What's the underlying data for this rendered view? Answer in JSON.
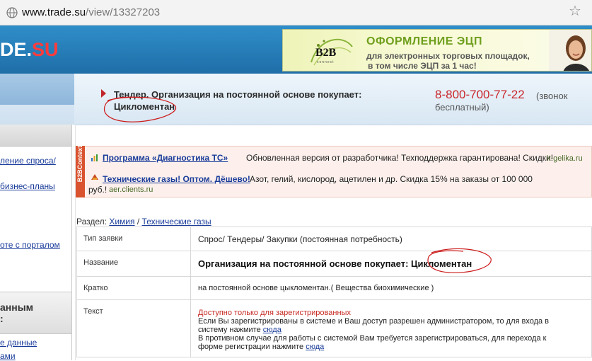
{
  "browser": {
    "url_domain": "www.trade.su",
    "url_path": "/view/13327203",
    "star_icon": "star-icon"
  },
  "header": {
    "logo_main": "DE",
    "logo_dot": ".",
    "logo_su": "SU"
  },
  "banner": {
    "brand": "B2B",
    "brand_sub": "connect",
    "title": "ОФОРМЛЕНИЕ ЭЦП",
    "line1": "для электронных торговых площадок,",
    "line2": "в том числе ЭЦП за 1 час!"
  },
  "tender": {
    "title_line1": "Тендер. Организация на постоянной основе покупает:",
    "title_line2": "Цикломентан"
  },
  "phone": {
    "number": "8-800-700-77-22",
    "note_part1": "(звонок",
    "note_part2": "бесплатный)"
  },
  "sidebar": {
    "links": [
      "ление спроса/",
      "бизнес-планы",
      "оте с порталом"
    ],
    "section_title_l1": "анным",
    "section_title_l2": ":",
    "bottom_links": [
      "е данные",
      "ами"
    ]
  },
  "ads": {
    "strip_label": "B2BContext",
    "items": [
      {
        "title": "Программа «Диагностика ТС»",
        "desc": "Обновленная версия от разработчика! Техподдержка гарантирована! Скидки!",
        "domain": "it-gelika.ru"
      },
      {
        "title": "Технические газы! Оптом. Дёшево!",
        "desc": "Азот, гелий, кислород, ацетилен и др. Скидка 15% на заказы от 100 000",
        "desc2": "руб.!",
        "domain": "aer.clients.ru"
      }
    ]
  },
  "breadcrumb": {
    "label": "Раздел:",
    "cat1": "Химия",
    "sep": "/",
    "cat2": "Технические газы"
  },
  "table": {
    "rows": [
      {
        "label": "Тип заявки",
        "value": "Спрос/ Тендеры/ Закупки (постоянная потребность)"
      },
      {
        "label": "Название",
        "value": "Организация на постоянной основе покупает: Цикломентан"
      },
      {
        "label": "Кратко",
        "value": "на постоянной основе цыкломентан.( Вещества биохимические )"
      },
      {
        "label": "Текст",
        "value": ""
      }
    ],
    "text_cell": {
      "restricted": "Доступно только для зарегистрированных",
      "line1": "Если Вы зарегистрированы в системе и Ваш доступ разрешен администратором, то для входа в",
      "line2_pre": "систему нажмите",
      "line2_link": "сюда",
      "line3": "В противном случае для работы с системой Вам требуется зарегистрироваться, для перехода к",
      "line4_pre": "форме регистрации нажмите",
      "line4_link": "сюда"
    }
  }
}
